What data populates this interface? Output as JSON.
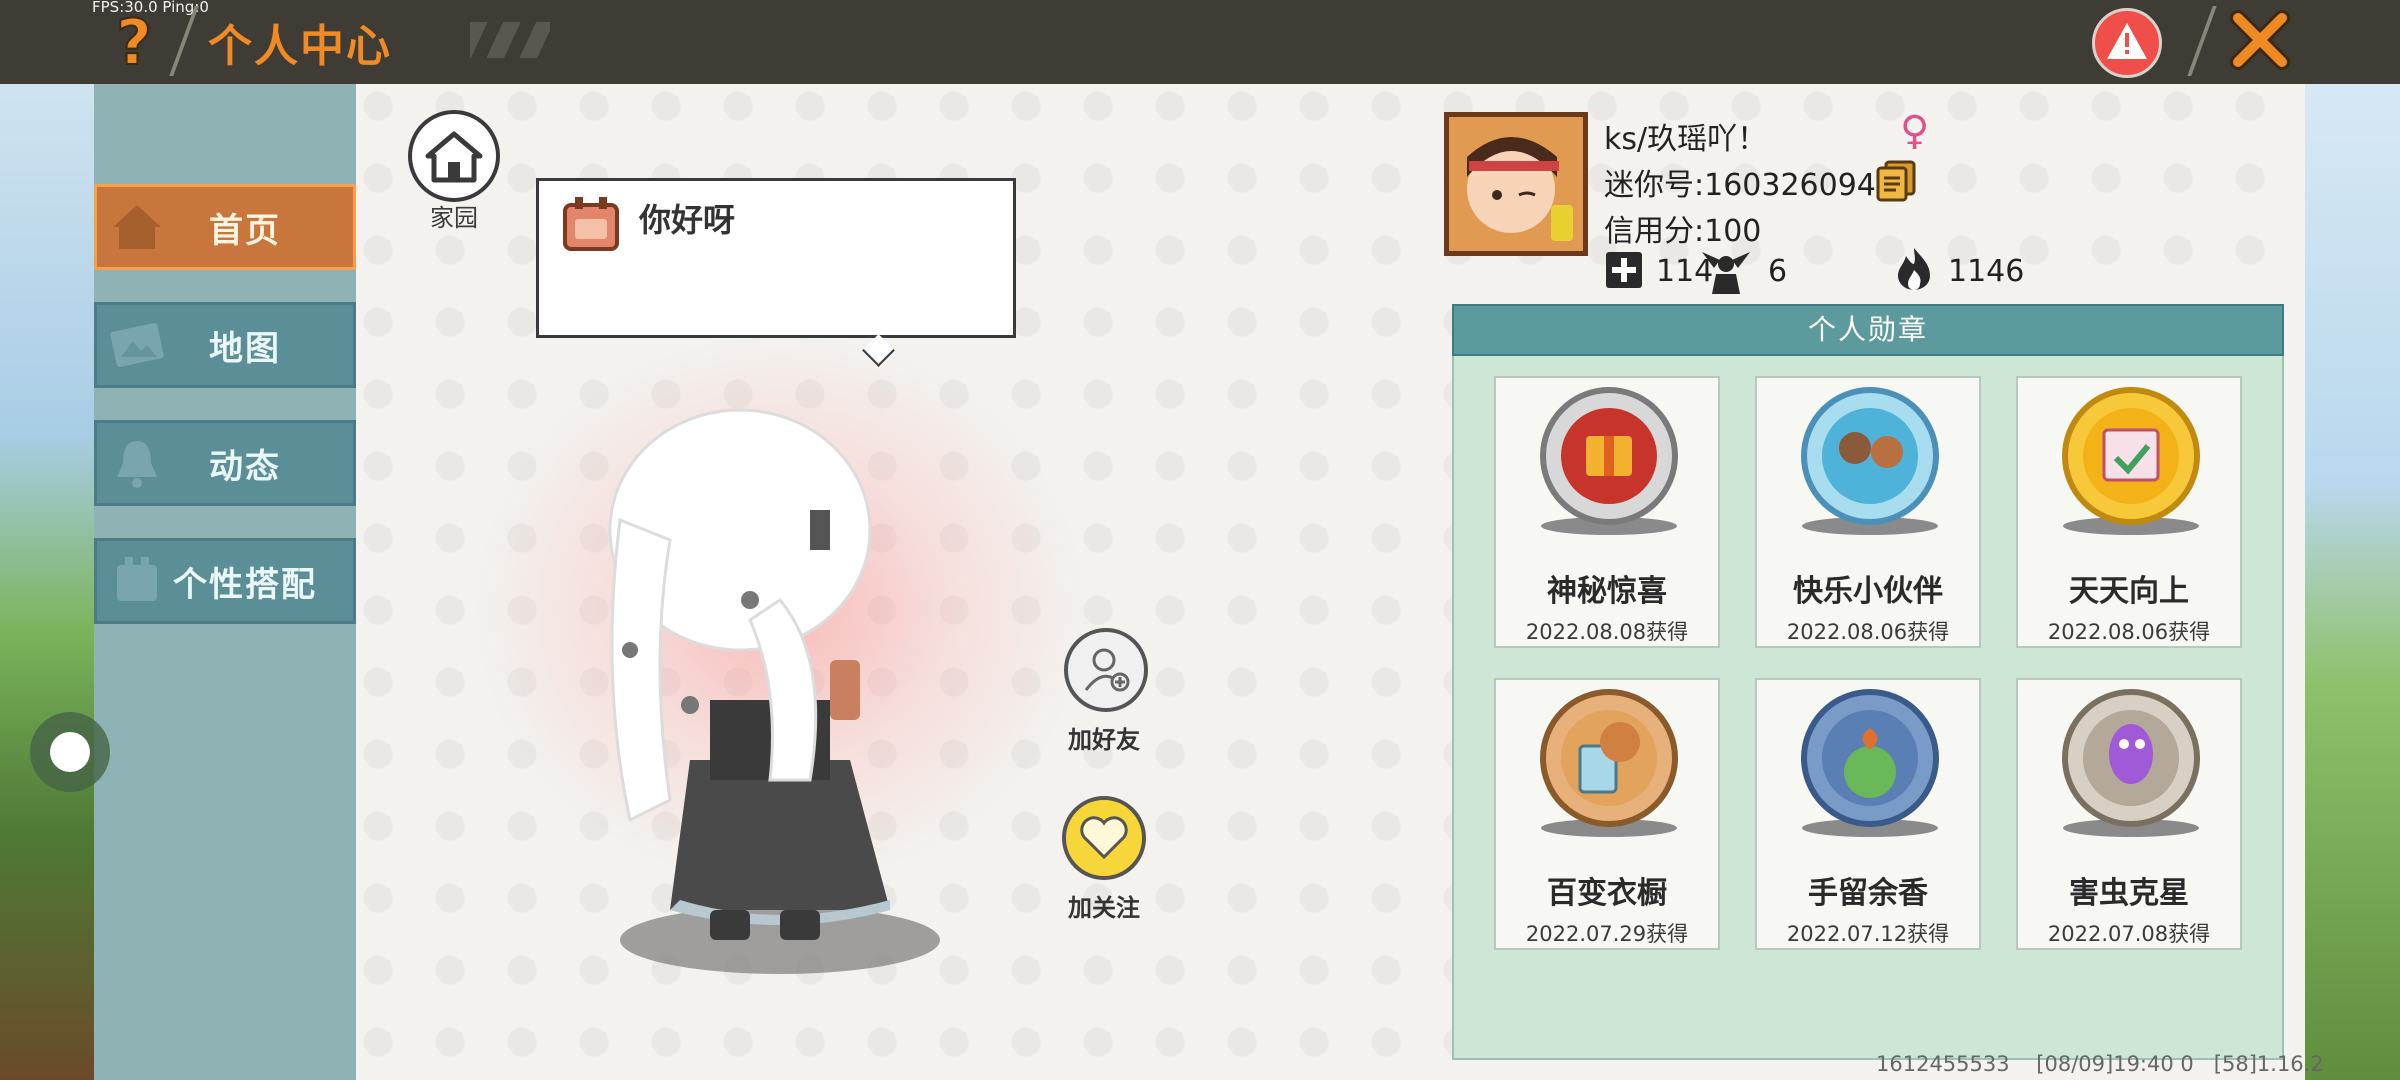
{
  "topbar": {
    "fps_text": "FPS:30.0  Ping:0",
    "title": "个人中心"
  },
  "sidebar": {
    "items": [
      {
        "label": "首页",
        "active": true
      },
      {
        "label": "地图",
        "active": false
      },
      {
        "label": "动态",
        "active": false
      },
      {
        "label": "个性搭配",
        "active": false
      }
    ]
  },
  "home": {
    "label": "家园"
  },
  "speech_bubble": {
    "text": "你好呀"
  },
  "actions": {
    "add_friend_label": "加好友",
    "follow_label": "加关注"
  },
  "profile": {
    "name": "ks/玖瑶吖！",
    "gender_symbol": "♀",
    "uid": "迷你号:1603260944",
    "credit": "信用分:100",
    "stats": {
      "friends": "114",
      "fans": "6",
      "popularity": "1146"
    }
  },
  "medals": {
    "title": "个人勋章",
    "items": [
      {
        "name": "神秘惊喜",
        "date": "2022.08.08获得",
        "color": "#c7342c"
      },
      {
        "name": "快乐小伙伴",
        "date": "2022.08.06获得",
        "color": "#4fb3d9"
      },
      {
        "name": "天天向上",
        "date": "2022.08.06获得",
        "color": "#f2b218"
      },
      {
        "name": "百变衣橱",
        "date": "2022.07.29获得",
        "color": "#e2a35c"
      },
      {
        "name": "手留余香",
        "date": "2022.07.12获得",
        "color": "#5a7fb5"
      },
      {
        "name": "害虫克星",
        "date": "2022.07.08获得",
        "color": "#b3a89a"
      }
    ]
  },
  "footer": {
    "text": "1612455533    [08/09]19:40 0   [58]1.16.2"
  },
  "colors": {
    "accent": "#f08a24",
    "topbar": "#3f3c36",
    "sidebar": "#8fb3b5",
    "panel_header": "#5d9a9e"
  }
}
